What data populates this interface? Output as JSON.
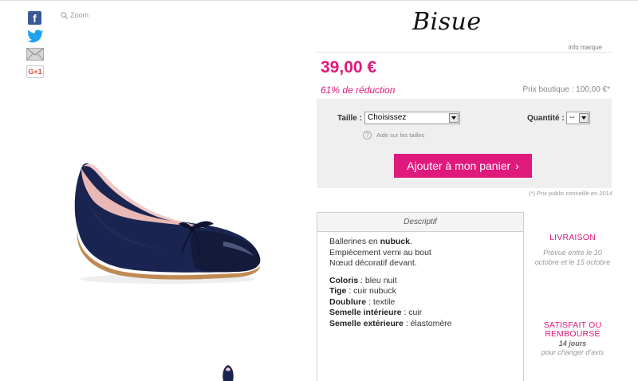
{
  "social": {
    "facebook": "f",
    "google_plus": "G+1"
  },
  "zoom": {
    "label": "Zoom"
  },
  "brand": {
    "name": "Bisue",
    "info_link": "info marque"
  },
  "pricing": {
    "price": "39,00 €",
    "discount": "61% de réduction",
    "retail": "Prix boutique : 100,00 €*"
  },
  "options": {
    "size_label": "Taille :",
    "size_value": "Choisissez",
    "size_help": "Aide sur les tailles",
    "qty_label": "Quantité :",
    "qty_value": "--",
    "cart_button": "Ajouter à mon panier",
    "footnote": "(*) Prix public conseillé en 2014"
  },
  "description": {
    "tab": "Descriptif",
    "intro": [
      {
        "text": "Ballerines en ",
        "bold": "nubuck",
        "after": "."
      },
      {
        "text": "Empiècement verni au bout"
      },
      {
        "text": "Nœud décoratif devant."
      }
    ],
    "specs": [
      {
        "label": "Coloris",
        "value": " : bleu nuit"
      },
      {
        "label": "Tige",
        "value": " : cuir nubuck"
      },
      {
        "label": "Doublure",
        "value": " : textile"
      },
      {
        "label": "Semelle intérieure",
        "value": " : cuir"
      },
      {
        "label": "Semelle extérieure",
        "value": " : élastomère"
      }
    ]
  },
  "delivery": {
    "title": "LIVRAISON",
    "text": "Prévue entre le 10 octobre et le 15 octobre"
  },
  "guarantee": {
    "title_line1": "SATISFAIT OU",
    "title_line2": "REMBOURSÉ",
    "days": "14 jours",
    "text": "pour changer d'avis"
  },
  "colors": {
    "accent": "#e0197d",
    "product": "#1a2450"
  }
}
